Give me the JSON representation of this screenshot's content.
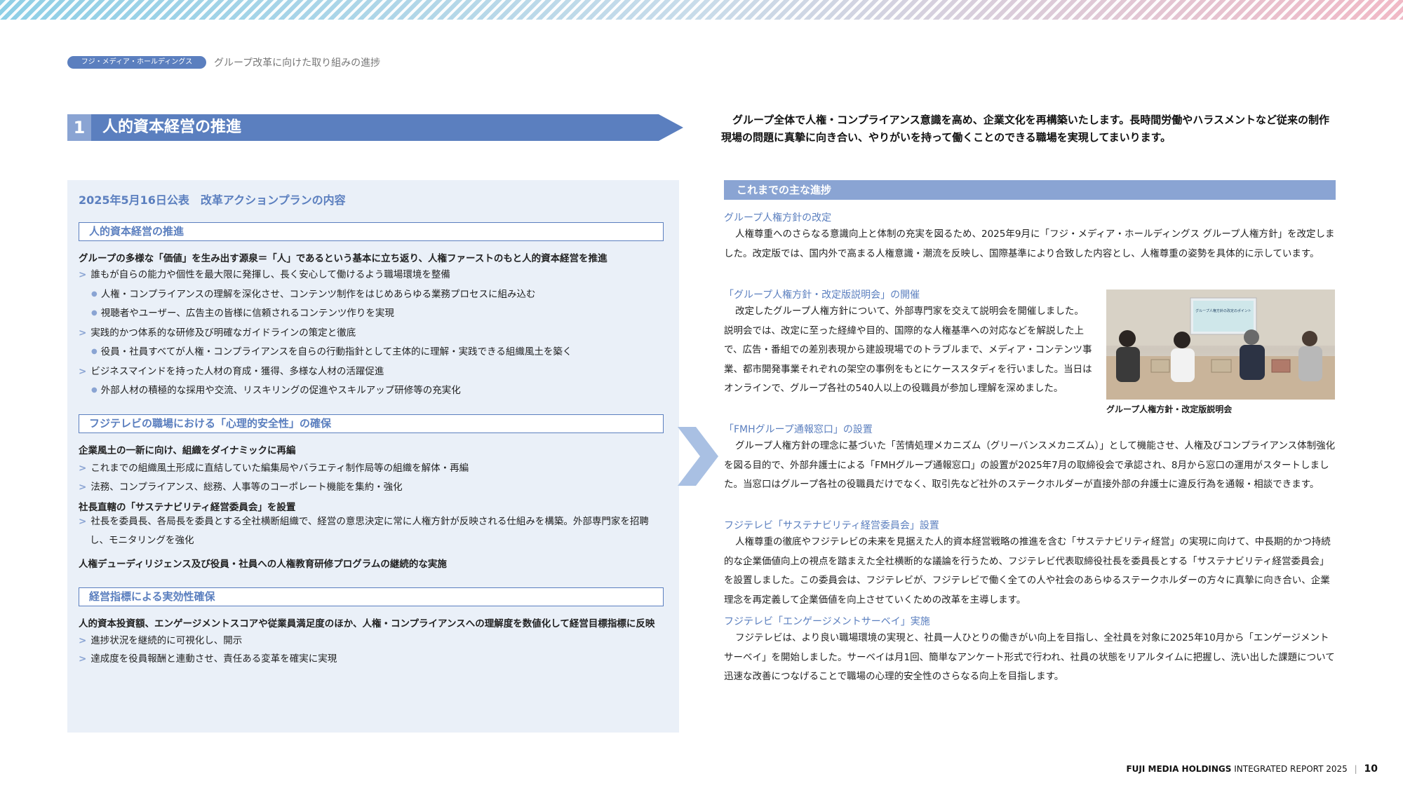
{
  "header": {
    "company_pill": "フジ・メディア・ホールディングス",
    "breadcrumb": "グループ改革に向けた取り組みの進捗"
  },
  "section": {
    "number": "1",
    "title": "人的資本経営の推進"
  },
  "intro_text": "グループ全体で人権・コンプライアンス意識を高め、企業文化を再構築いたします。長時間労働やハラスメントなど従来の制作現場の問題に真摯に向き合い、やりがいを持って働くことのできる職場を実現してまいります。",
  "left_panel": {
    "heading": "2025年5月16日公表　改革アクションプランの内容",
    "box1": {
      "title": "人的資本経営の推進",
      "lead": "グループの多様な「価値」を生み出す源泉＝「人」であるという基本に立ち返り、人権ファーストのもと人的資本経営を推進",
      "b1": "誰もが自らの能力や個性を最大限に発揮し、長く安心して働けるよう職場環境を整備",
      "b1_s1": "人権・コンプライアンスの理解を深化させ、コンテンツ制作をはじめあらゆる業務プロセスに組み込む",
      "b1_s2": "視聴者やユーザー、広告主の皆様に信頼されるコンテンツ作りを実現",
      "b2": "実践的かつ体系的な研修及び明確なガイドラインの策定と徹底",
      "b2_s1": "役員・社員すべてが人権・コンプライアンスを自らの行動指針として主体的に理解・実践できる組織風土を築く",
      "b3": "ビジネスマインドを持った人材の育成・獲得、多様な人材の活躍促進",
      "b3_s1": "外部人材の積極的な採用や交流、リスキリングの促進やスキルアップ研修等の充実化"
    },
    "box2": {
      "title": "フジテレビの職場における「心理的安全性」の確保",
      "lead1": "企業風土の一新に向け、組織をダイナミックに再編",
      "b1": "これまでの組織風土形成に直結していた編集局やバラエティ制作局等の組織を解体・再編",
      "b2": "法務、コンプライアンス、総務、人事等のコーポレート機能を集約・強化",
      "lead2": "社長直轄の「サステナビリティ経営委員会」を設置",
      "b3": "社長を委員長、各局長を委員とする全社横断組織で、経営の意思決定に常に人権方針が反映される仕組みを構築。外部専門家を招聘し、モニタリングを強化",
      "lead3": "人権デューディリジェンス及び役員・社員への人権教育研修プログラムの継続的な実施"
    },
    "box3": {
      "title": "経営指標による実効性確保",
      "lead": "人的資本投資額、エンゲージメントスコアや従業員満足度のほか、人権・コンプライアンスへの理解度を数値化して経営目標指標に反映",
      "b1": "進捗状況を継続的に可視化し、開示",
      "b2": "達成度を役員報酬と連動させ、責任ある変革を確実に実現"
    }
  },
  "right_panel": {
    "heading": "これまでの主な進捗",
    "items": [
      {
        "title": "グループ人権方針の改定",
        "text": "人権尊重へのさらなる意識向上と体制の充実を図るため、2025年9月に「フジ・メディア・ホールディングス グループ人権方針」を改定しました。改定版では、国内外で高まる人権意識・潮流を反映し、国際基準により合致した内容とし、人権尊重の姿勢を具体的に示しています。"
      },
      {
        "title": "「グループ人権方針・改定版説明会」の開催",
        "text": "改定したグループ人権方針について、外部専門家を交えて説明会を開催しました。説明会では、改定に至った経緯や目的、国際的な人権基準への対応などを解説した上で、広告・番組での差別表現から建設現場でのトラブルまで、メディア・コンテンツ事業、都市開発事業それぞれの架空の事例をもとにケーススタディを行いました。当日はオンラインで、グループ各社の540人以上の役職員が参加し理解を深めました。"
      },
      {
        "title": "「FMHグループ通報窓口」の設置",
        "text": "グループ人権方針の理念に基づいた「苦情処理メカニズム（グリーバンスメカニズム）」として機能させ、人権及びコンプライアンス体制強化を図る目的で、外部弁護士による「FMHグループ通報窓口」の設置が2025年7月の取締役会で承認され、8月から窓口の運用がスタートしました。当窓口はグループ各社の役職員だけでなく、取引先など社外のステークホルダーが直接外部の弁護士に違反行為を通報・相談できます。"
      },
      {
        "title": "フジテレビ「サステナビリティ経営委員会」設置",
        "text": "人権尊重の徹底やフジテレビの未来を見据えた人的資本経営戦略の推進を含む「サステナビリティ経営」の実現に向けて、中長期的かつ持続的な企業価値向上の視点を踏まえた全社横断的な議論を行うため、フジテレビ代表取締役社長を委員長とする「サステナビリティ経営委員会」を設置しました。この委員会は、フジテレビが、フジテレビで働く全ての人や社会のあらゆるステークホルダーの方々に真摯に向き合い、企業理念を再定義して企業価値を向上させていくための改革を主導します。"
      },
      {
        "title": "フジテレビ「エンゲージメントサーベイ」実施",
        "text": "フジテレビは、より良い職場環境の実現と、社員一人ひとりの働きがい向上を目指し、全社員を対象に2025年10月から「エンゲージメントサーベイ」を開始しました。サーベイは月1回、簡単なアンケート形式で行われ、社員の状態をリアルタイムに把握し、洗い出した課題について迅速な改善につなげることで職場の心理的安全性のさらなる向上を目指します。"
      }
    ],
    "photo_caption": "グループ人権方針・改定版説明会",
    "photo_slide_text": "グループ人権方針の改定のポイント"
  },
  "footer": {
    "brand": "FUJI MEDIA HOLDINGS",
    "report": "INTEGRATED REPORT 2025",
    "page": "10"
  },
  "colors": {
    "accent": "#5b7fbf",
    "accent_light": "#8aa4d3",
    "panel_bg": "#eaf0f8"
  }
}
